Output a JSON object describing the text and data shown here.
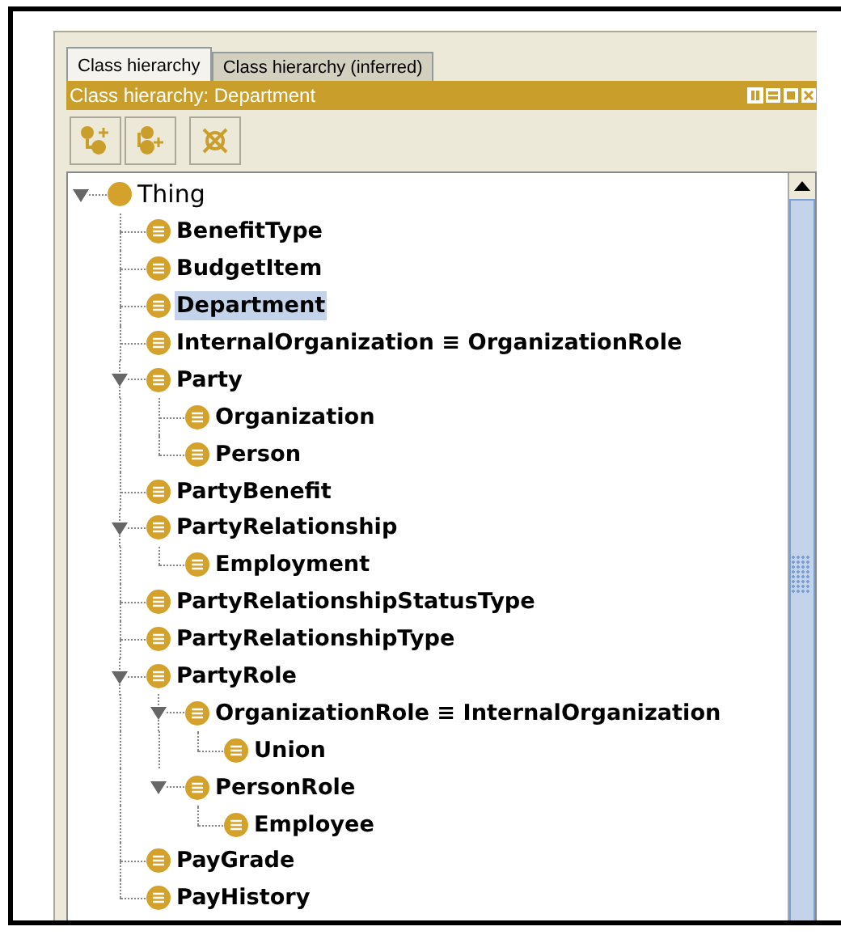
{
  "tabs": [
    {
      "label": "Class hierarchy",
      "selected": true
    },
    {
      "label": "Class hierarchy (inferred)",
      "selected": false
    }
  ],
  "pane": {
    "title": "Class hierarchy: Department"
  },
  "tree": {
    "root": {
      "label": "Thing",
      "expanded": true,
      "selected": false
    },
    "children": [
      {
        "label": "BenefitType",
        "selected": false
      },
      {
        "label": "BudgetItem",
        "selected": false
      },
      {
        "label": "Department",
        "selected": true
      },
      {
        "label": "InternalOrganization ≡ OrganizationRole",
        "selected": false
      },
      {
        "label": "Party",
        "selected": false,
        "expanded": true,
        "children": [
          {
            "label": "Organization",
            "selected": false
          },
          {
            "label": "Person",
            "selected": false
          }
        ]
      },
      {
        "label": "PartyBenefit",
        "selected": false
      },
      {
        "label": "PartyRelationship",
        "selected": false,
        "expanded": true,
        "children": [
          {
            "label": "Employment",
            "selected": false
          }
        ]
      },
      {
        "label": "PartyRelationshipStatusType",
        "selected": false
      },
      {
        "label": "PartyRelationshipType",
        "selected": false
      },
      {
        "label": "PartyRole",
        "selected": false,
        "expanded": true,
        "children": [
          {
            "label": "OrganizationRole ≡ InternalOrganization",
            "selected": false,
            "expanded": true,
            "children": [
              {
                "label": "Union",
                "selected": false
              }
            ]
          },
          {
            "label": "PersonRole",
            "selected": false,
            "expanded": true,
            "children": [
              {
                "label": "Employee",
                "selected": false
              }
            ]
          }
        ]
      },
      {
        "label": "PayGrade",
        "selected": false
      },
      {
        "label": "PayHistory",
        "selected": false
      }
    ]
  }
}
